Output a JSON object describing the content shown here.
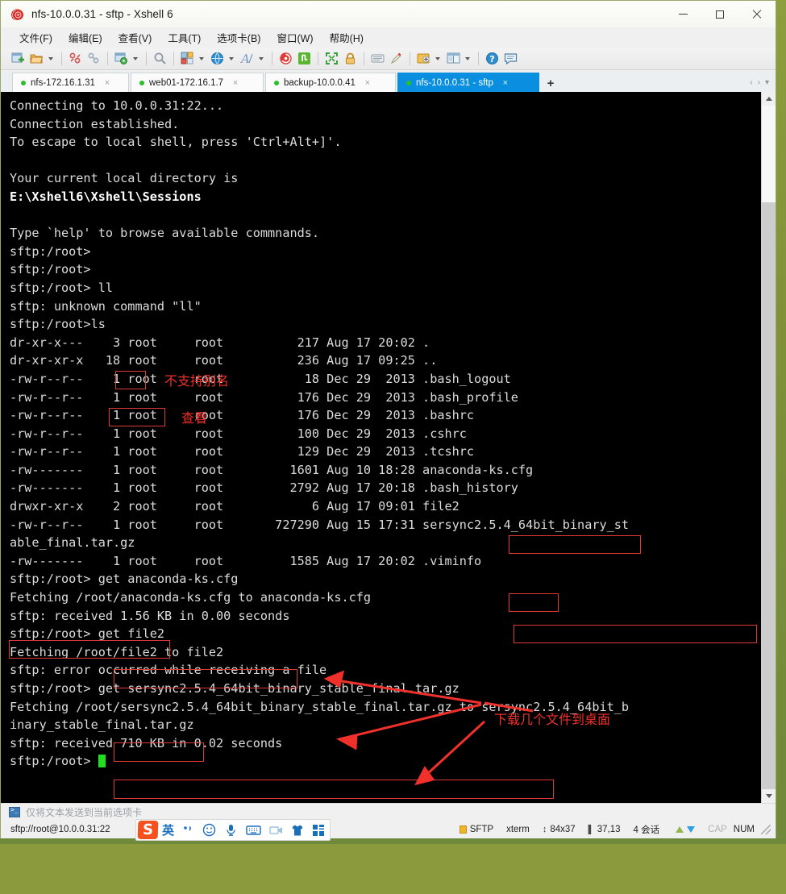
{
  "window": {
    "title": "nfs-10.0.0.31 - sftp - Xshell 6",
    "logo_icon": "xshell-rose-icon",
    "minimize_label": "–",
    "maximize_label": "□",
    "close_label": "✕"
  },
  "menubar": {
    "items": [
      {
        "label": "文件(F)",
        "name": "menu-file"
      },
      {
        "label": "编辑(E)",
        "name": "menu-edit"
      },
      {
        "label": "查看(V)",
        "name": "menu-view"
      },
      {
        "label": "工具(T)",
        "name": "menu-tools"
      },
      {
        "label": "选项卡(B)",
        "name": "menu-tabs"
      },
      {
        "label": "窗口(W)",
        "name": "menu-window"
      },
      {
        "label": "帮助(H)",
        "name": "menu-help"
      }
    ]
  },
  "toolbar": {
    "buttons": [
      "new-session-icon",
      "open-folder-icon",
      "caret-down-icon",
      "sep",
      "disconnect-icon",
      "reconnect-icon",
      "sep",
      "properties-icon",
      "caret-down-icon",
      "sep",
      "find-icon",
      "sep",
      "layout-icon",
      "caret-down-icon",
      "globe-icon",
      "caret-down-icon",
      "font-icon",
      "caret-down-icon",
      "sep",
      "xftp-icon",
      "xagent-icon",
      "sep",
      "fullscreen-icon",
      "lock-icon",
      "sep",
      "compose-icon",
      "highlight-icon",
      "sep",
      "transfer-icon",
      "caret-down-icon",
      "split-icon",
      "caret-down-icon",
      "sep",
      "help-icon",
      "feedback-icon"
    ]
  },
  "tabs": {
    "items": [
      {
        "label": "nfs-172.16.1.31",
        "active": false,
        "status": "connected"
      },
      {
        "label": "web01-172.16.1.7",
        "active": false,
        "status": "connected"
      },
      {
        "label": "backup-10.0.0.41",
        "active": false,
        "status": "connected"
      },
      {
        "label": "nfs-10.0.0.31 - sftp",
        "active": true,
        "status": "connected"
      }
    ],
    "close_label": "×",
    "add_label": "+",
    "nav_prev": "‹",
    "nav_next": "›",
    "nav_list": "▾"
  },
  "terminal": {
    "lines": [
      {
        "text": "Connecting to 10.0.0.31:22...",
        "bold": false
      },
      {
        "text": "Connection established.",
        "bold": false
      },
      {
        "text": "To escape to local shell, press 'Ctrl+Alt+]'.",
        "bold": false
      },
      {
        "text": "",
        "bold": false
      },
      {
        "text": "Your current local directory is",
        "bold": false
      },
      {
        "text": "E:\\Xshell6\\Xshell\\Sessions",
        "bold": true
      },
      {
        "text": "",
        "bold": false
      },
      {
        "text": "Type `help' to browse available commnands.",
        "bold": false
      },
      {
        "text": "sftp:/root>",
        "bold": false
      },
      {
        "text": "sftp:/root>",
        "bold": false
      },
      {
        "text": "sftp:/root> ll",
        "bold": false
      },
      {
        "text": "sftp: unknown command \"ll\"",
        "bold": false
      },
      {
        "text": "sftp:/root>ls",
        "bold": false
      },
      {
        "text": "dr-xr-x---    3 root     root          217 Aug 17 20:02 .",
        "bold": false
      },
      {
        "text": "dr-xr-xr-x   18 root     root          236 Aug 17 09:25 ..",
        "bold": false
      },
      {
        "text": "-rw-r--r--    1 root     root           18 Dec 29  2013 .bash_logout",
        "bold": false
      },
      {
        "text": "-rw-r--r--    1 root     root          176 Dec 29  2013 .bash_profile",
        "bold": false
      },
      {
        "text": "-rw-r--r--    1 root     root          176 Dec 29  2013 .bashrc",
        "bold": false
      },
      {
        "text": "-rw-r--r--    1 root     root          100 Dec 29  2013 .cshrc",
        "bold": false
      },
      {
        "text": "-rw-r--r--    1 root     root          129 Dec 29  2013 .tcshrc",
        "bold": false
      },
      {
        "text": "-rw-------    1 root     root         1601 Aug 10 18:28 anaconda-ks.cfg",
        "bold": false
      },
      {
        "text": "-rw-------    1 root     root         2792 Aug 17 20:18 .bash_history",
        "bold": false
      },
      {
        "text": "drwxr-xr-x    2 root     root            6 Aug 17 09:01 file2",
        "bold": false
      },
      {
        "text": "-rw-r--r--    1 root     root       727290 Aug 15 17:31 sersync2.5.4_64bit_binary_st",
        "bold": false
      },
      {
        "text": "able_final.tar.gz",
        "bold": false
      },
      {
        "text": "-rw-------    1 root     root         1585 Aug 17 20:02 .viminfo",
        "bold": false
      },
      {
        "text": "sftp:/root> get anaconda-ks.cfg",
        "bold": false
      },
      {
        "text": "Fetching /root/anaconda-ks.cfg to anaconda-ks.cfg",
        "bold": false
      },
      {
        "text": "sftp: received 1.56 KB in 0.00 seconds",
        "bold": false
      },
      {
        "text": "sftp:/root> get file2",
        "bold": false
      },
      {
        "text": "Fetching /root/file2 to file2",
        "bold": false
      },
      {
        "text": "sftp: error occurred while receiving a file",
        "bold": false
      },
      {
        "text": "sftp:/root> get sersync2.5.4_64bit_binary_stable_final.tar.gz",
        "bold": false
      },
      {
        "text": "Fetching /root/sersync2.5.4_64bit_binary_stable_final.tar.gz to sersync2.5.4_64bit_b",
        "bold": false
      },
      {
        "text": "inary_stable_final.tar.gz",
        "bold": false
      },
      {
        "text": "sftp: received 710 KB in 0.02 seconds",
        "bold": false
      }
    ],
    "prompt_last": "sftp:/root> ",
    "cursor_color": "#20e020",
    "fg_color": "#dcdcdc",
    "bg_color": "#000000"
  },
  "annotations": {
    "color": "#f0302a",
    "notes": [
      {
        "text": "不支持别名",
        "name": "annotation-no-alias"
      },
      {
        "text": "查看",
        "name": "annotation-view"
      },
      {
        "text": "下载几个文件到桌面",
        "name": "annotation-download-files"
      }
    ]
  },
  "send_bar": {
    "icon": "terminal-icon",
    "label": "仅将文本发送到当前选项卡"
  },
  "statusbar": {
    "url": "sftp://root@10.0.0.31:22",
    "protocol": "SFTP",
    "term_type": "xterm",
    "size": "84x37",
    "cursor_pos": "37,13",
    "sessions": "4 会话",
    "caps": "CAP",
    "num": "NUM",
    "size_icon": "resize-icon",
    "cursor_icon": "cursor-icon",
    "upload_icon": "arrow-up-icon",
    "download_icon": "arrow-down-icon",
    "lock_icon": "lock-icon",
    "grip_icon": "resize-grip-icon"
  },
  "ime": {
    "logo": "S",
    "mode": "英",
    "icons": [
      "sogou-logo-icon",
      "lang-english-icon",
      "pinyin-icon",
      "emoji-icon",
      "voice-icon",
      "keyboard-icon",
      "screenshot-icon",
      "skin-icon",
      "toolbox-icon"
    ]
  }
}
